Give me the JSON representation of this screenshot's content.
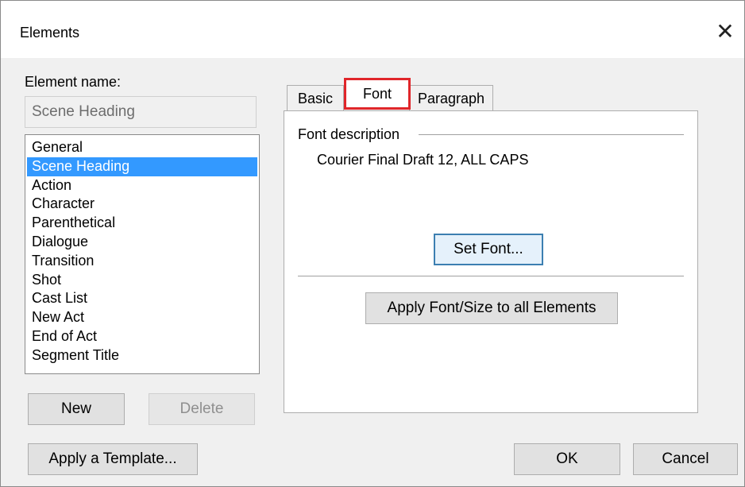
{
  "window": {
    "title": "Elements",
    "close_glyph": "✕"
  },
  "left": {
    "element_name_label": "Element name:",
    "element_name_value": "Scene Heading",
    "list_items": [
      "General",
      "Scene Heading",
      "Action",
      "Character",
      "Parenthetical",
      "Dialogue",
      "Transition",
      "Shot",
      "Cast List",
      "New Act",
      "End of Act",
      "Segment Title"
    ],
    "selected_item": "Scene Heading",
    "new_label": "New",
    "delete_label": "Delete",
    "apply_template_label": "Apply a Template..."
  },
  "tabs": [
    {
      "label": "Basic"
    },
    {
      "label": "Font"
    },
    {
      "label": "Paragraph"
    }
  ],
  "active_tab": "Font",
  "font_panel": {
    "group_label": "Font description",
    "description": "Courier Final Draft 12, ALL CAPS",
    "set_font_label": "Set Font...",
    "apply_all_label": "Apply Font/Size to all Elements"
  },
  "footer": {
    "ok_label": "OK",
    "cancel_label": "Cancel"
  },
  "colors": {
    "selection": "#3399ff",
    "active_tab_highlight": "#e0262a",
    "dialog_bg": "#f0f0f0"
  }
}
